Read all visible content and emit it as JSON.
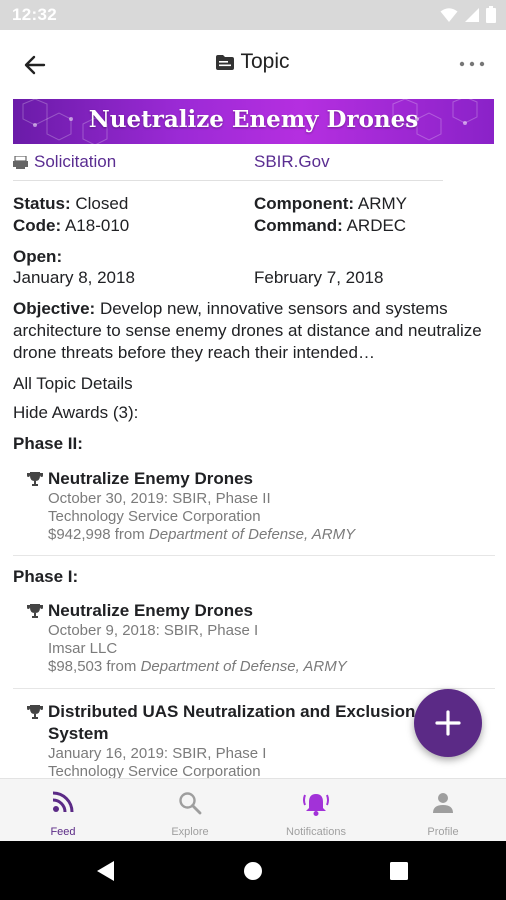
{
  "status_bar": {
    "time": "12:32"
  },
  "app_bar": {
    "title": "Topic"
  },
  "banner": {
    "title": "Nuetralize Enemy Drones"
  },
  "links": {
    "solicitation": "Solicitation",
    "sbir": "SBIR.Gov"
  },
  "details": {
    "status_label": "Status:",
    "status_value": "Closed",
    "code_label": "Code:",
    "code_value": "A18-010",
    "component_label": "Component:",
    "component_value": "ARMY",
    "command_label": "Command:",
    "command_value": "ARDEC",
    "open_label": "Open:",
    "open_date": "January 8, 2018",
    "close_date": "February 7, 2018"
  },
  "objective": {
    "label": "Objective:",
    "text": "Develop new, innovative sensors and systems architecture to sense enemy drones at distance and neutralize drone threats before they reach their intended…"
  },
  "actions": {
    "all_details": "All Topic Details",
    "hide_awards": "Hide Awards (3):"
  },
  "phases": [
    {
      "heading": "Phase II:",
      "awards": [
        {
          "title": "Neutralize Enemy Drones",
          "date_line": "October 30, 2019: SBIR, Phase II",
          "company": "Technology Service Corporation",
          "amount": "$942,998 from",
          "agency": "Department of Defense, ARMY"
        }
      ]
    },
    {
      "heading": "Phase I:",
      "awards": [
        {
          "title": "Neutralize Enemy Drones",
          "date_line": "October 9, 2018: SBIR, Phase I",
          "company": "Imsar LLC",
          "amount": "$98,503 from",
          "agency": "Department of Defense, ARMY"
        },
        {
          "title": "Distributed UAS Neutralization and Exclusion System",
          "date_line": "January 16, 2019: SBIR, Phase I",
          "company": "Technology Service Corporation"
        }
      ]
    }
  ],
  "bottom_nav": [
    {
      "label": "Feed",
      "icon": "rss-icon"
    },
    {
      "label": "Explore",
      "icon": "search-icon"
    },
    {
      "label": "Notifications",
      "icon": "bell-icon"
    },
    {
      "label": "Profile",
      "icon": "person-icon"
    }
  ],
  "colors": {
    "accent": "#5b2a86",
    "link": "#5a2d91",
    "banner_start": "#6a1ba8",
    "banner_end": "#b52fe0"
  }
}
